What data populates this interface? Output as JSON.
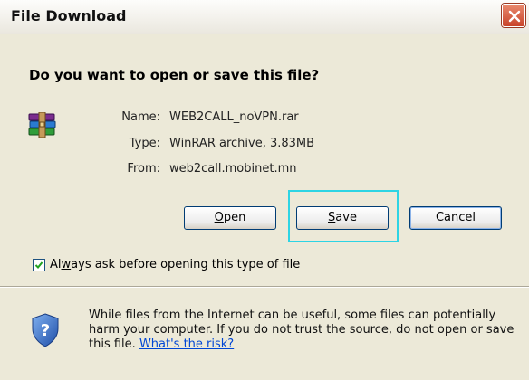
{
  "window": {
    "title": "File Download"
  },
  "dialog": {
    "question": "Do you want to open or save this file?",
    "file_icon": "winrar-archive-icon",
    "info": [
      {
        "label": "Name:",
        "value": "WEB2CALL_noVPN.rar"
      },
      {
        "label": "Type:",
        "value": "WinRAR archive, 3.83MB"
      },
      {
        "label": "From:",
        "value": "web2call.mobinet.mn"
      }
    ],
    "buttons": {
      "open": {
        "mnemonic": "O",
        "rest": "pen"
      },
      "save": {
        "mnemonic": "S",
        "rest": "ave"
      },
      "cancel": {
        "label": "Cancel"
      }
    },
    "checkbox": {
      "pre": "Al",
      "mnemonic": "w",
      "post": "ays ask before opening this type of file",
      "checked": true
    },
    "warning": {
      "text": "While files from the Internet can be useful, some files can potentially harm your computer. If you do not trust the source, do not open or save this file.",
      "link": "What's the risk?"
    }
  },
  "colors": {
    "focus_highlight": "#2dd4e4",
    "link": "#0046d5",
    "close_button": "#c8442b"
  }
}
